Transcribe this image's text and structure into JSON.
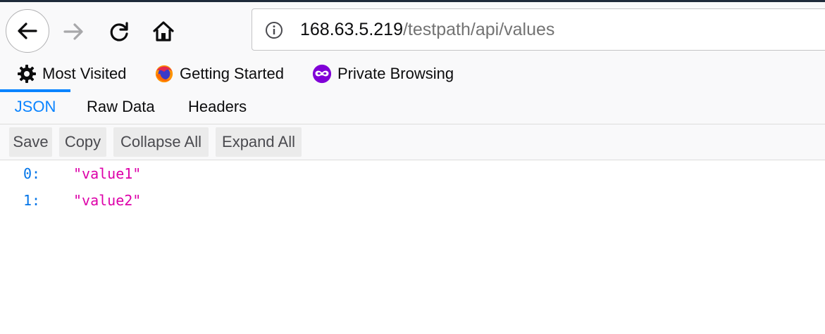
{
  "browser": {
    "url": {
      "host": "168.63.5.219",
      "path": "/testpath/api/values"
    },
    "nav": {
      "back_icon": "back-arrow-icon",
      "forward_icon": "forward-arrow-icon",
      "reload_icon": "reload-icon",
      "home_icon": "home-icon",
      "info_icon": "info-icon"
    },
    "bookmarks": [
      {
        "label": "Most Visited",
        "icon": "gear-icon"
      },
      {
        "label": "Getting Started",
        "icon": "firefox-logo-icon"
      },
      {
        "label": "Private Browsing",
        "icon": "private-mask-icon"
      }
    ]
  },
  "viewer": {
    "tabs": [
      {
        "label": "JSON",
        "active": true
      },
      {
        "label": "Raw Data",
        "active": false
      },
      {
        "label": "Headers",
        "active": false
      }
    ],
    "toolbar": {
      "save": "Save",
      "copy": "Copy",
      "collapse_all": "Collapse All",
      "expand_all": "Expand All"
    },
    "rows": [
      {
        "key": "0:",
        "value": "\"value1\""
      },
      {
        "key": "1:",
        "value": "\"value2\""
      }
    ]
  },
  "colors": {
    "accent": "#0a84ff",
    "json_key": "#0074e8",
    "json_string": "#dd00a9",
    "toolbar_bg": "#f9f9fa"
  }
}
